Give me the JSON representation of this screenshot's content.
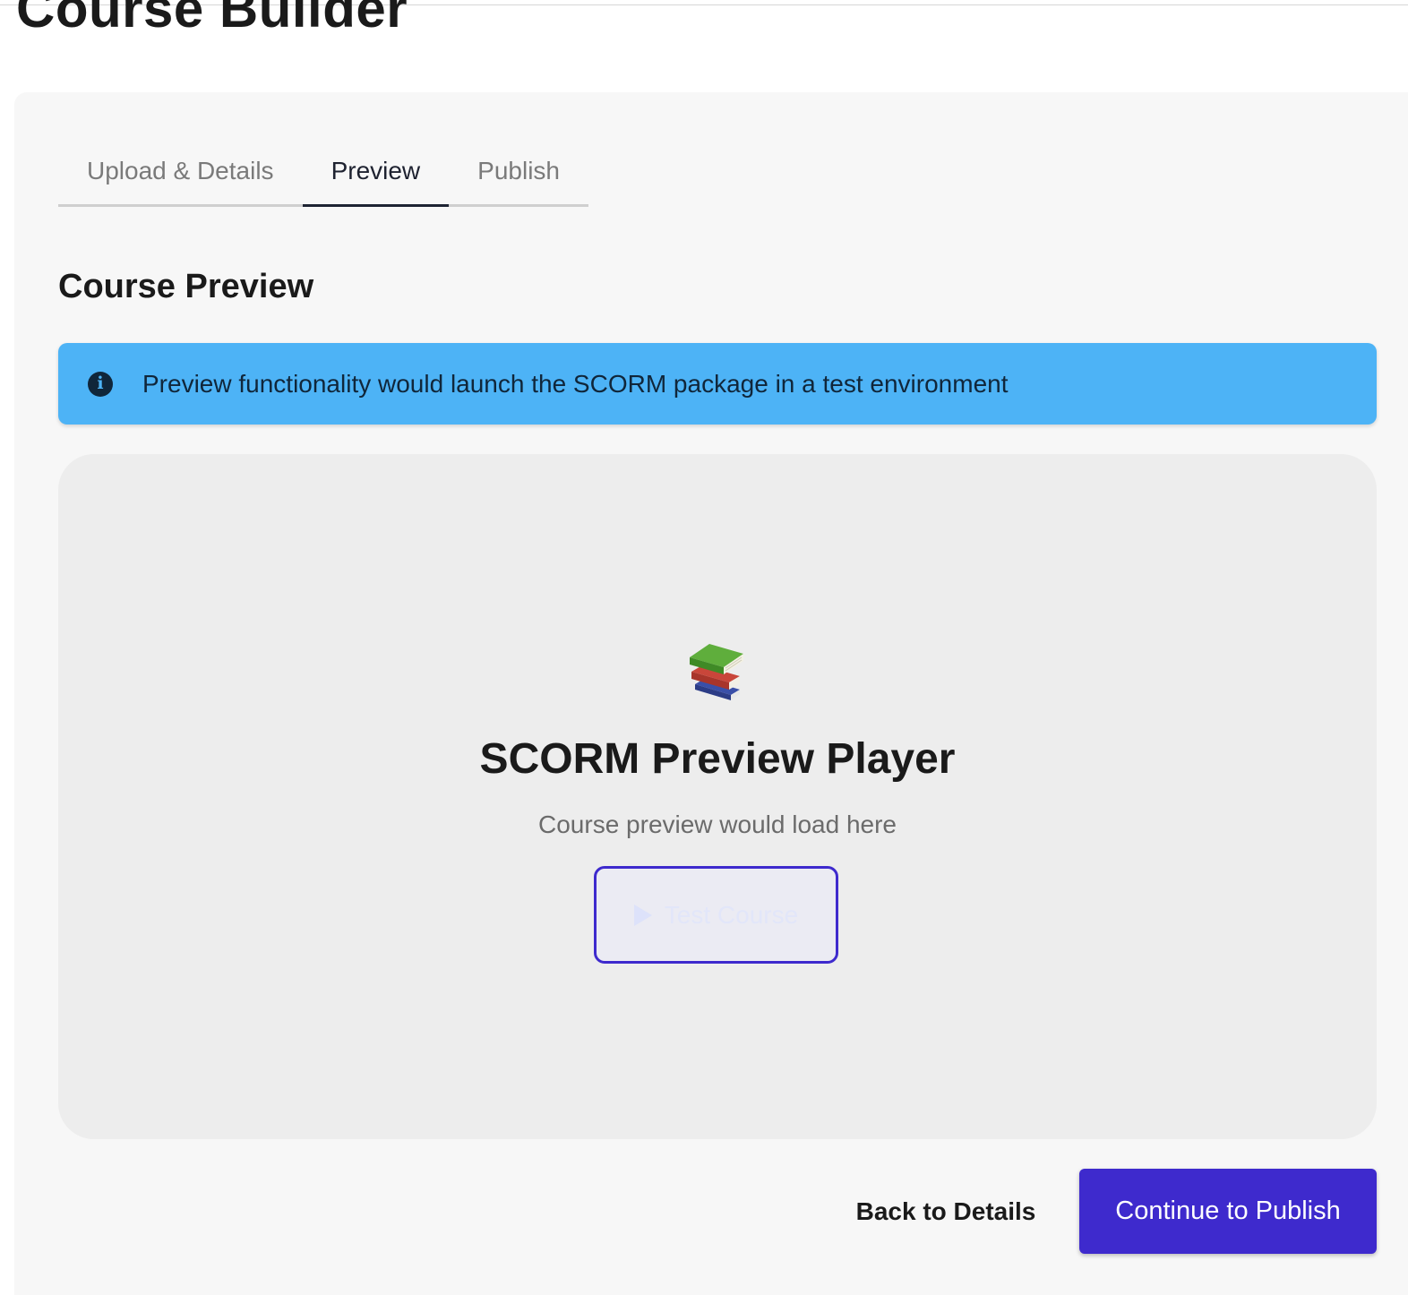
{
  "page": {
    "title": "Course Builder"
  },
  "tabs": [
    {
      "label": "Upload & Details",
      "active": false
    },
    {
      "label": "Preview",
      "active": true
    },
    {
      "label": "Publish",
      "active": false
    }
  ],
  "section": {
    "title": "Course Preview"
  },
  "alert": {
    "icon": "info-icon",
    "text": "Preview functionality would launch the SCORM package in a test environment",
    "color": "#4db3f6"
  },
  "player": {
    "icon": "books-icon",
    "title": "SCORM Preview Player",
    "subtitle": "Course preview would load here",
    "test_button": {
      "label": "Test Course",
      "icon": "play-icon"
    }
  },
  "footer": {
    "back_label": "Back to Details",
    "continue_label": "Continue to Publish",
    "accent_color": "#3e2acd"
  }
}
